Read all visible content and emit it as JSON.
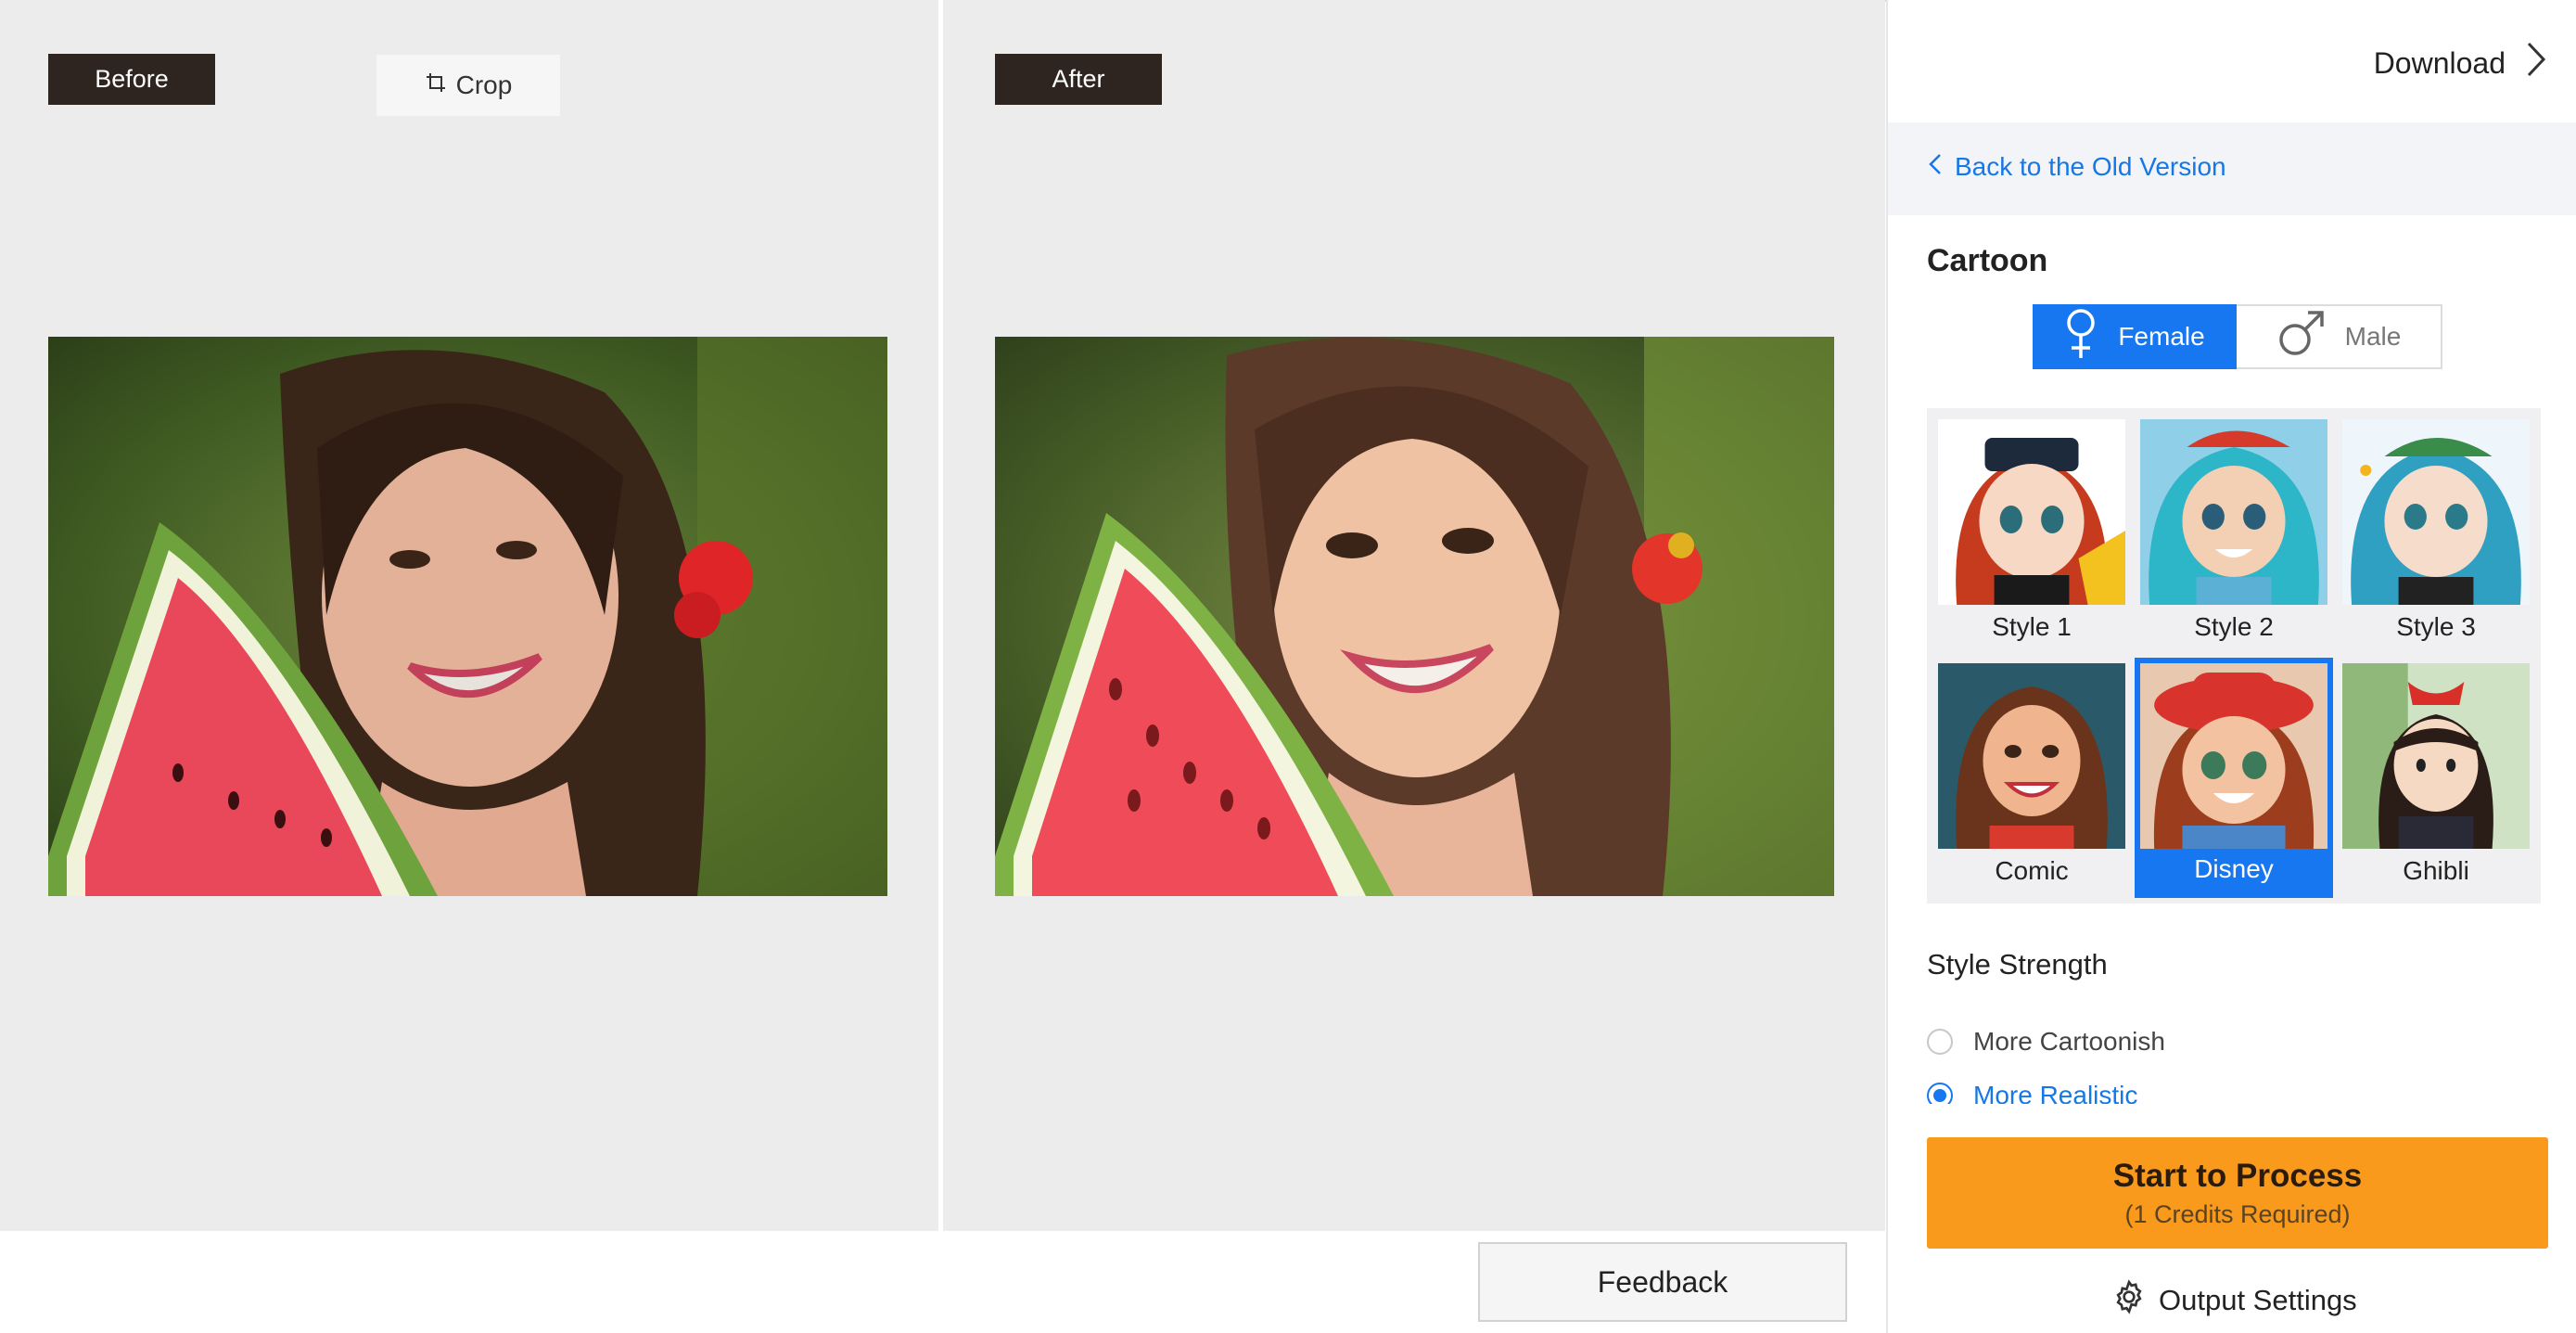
{
  "preview": {
    "before_label": "Before",
    "after_label": "After",
    "crop_label": "Crop"
  },
  "feedback_label": "Feedback",
  "panel": {
    "download_label": "Download",
    "back_label": "Back to the Old Version",
    "section_title": "Cartoon",
    "gender": {
      "female": "Female",
      "male": "Male",
      "selected": "Female"
    },
    "styles": [
      {
        "label": "Style 1"
      },
      {
        "label": "Style 2"
      },
      {
        "label": "Style 3"
      },
      {
        "label": "Comic"
      },
      {
        "label": "Disney"
      },
      {
        "label": "Ghibli"
      }
    ],
    "selected_style": "Disney",
    "strength": {
      "title": "Style Strength",
      "options": [
        "More Cartoonish",
        "More Realistic"
      ],
      "selected": "More Realistic"
    },
    "process": {
      "label": "Start to Process",
      "sub": "(1 Credits Required)"
    },
    "output_settings_label": "Output Settings"
  },
  "colors": {
    "accent": "#1677f0",
    "process": "#f99a1c",
    "tag_bg": "#2e2420",
    "pane_bg": "#ececed"
  }
}
